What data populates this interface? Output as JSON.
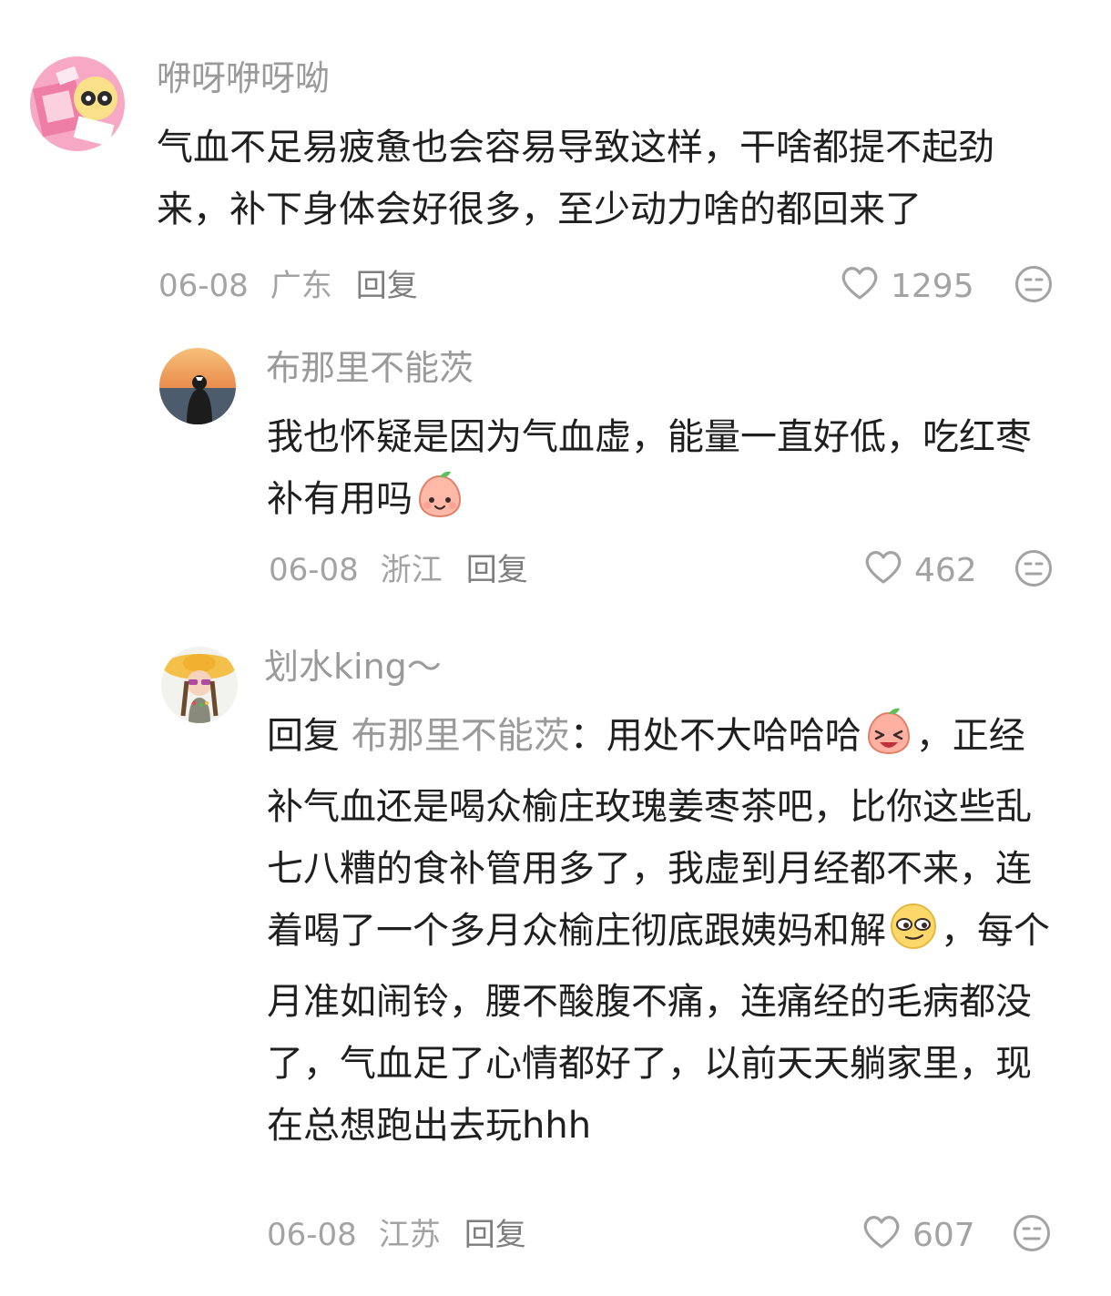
{
  "comments": [
    {
      "username": "咿呀咿呀呦",
      "text": "气血不足易疲惫也会容易导致这样，干啥都提不起劲来，补下身体会好很多，至少动力啥的都回来了",
      "date": "06-08",
      "location": "广东",
      "reply_label": "回复",
      "likes": "1295"
    },
    {
      "username": "布那里不能茨",
      "text": "我也怀疑是因为气血虚，能量一直好低，吃红枣补有用吗",
      "emoji": "smiling-peach-emoji",
      "date": "06-08",
      "location": "浙江",
      "reply_label": "回复",
      "likes": "462"
    },
    {
      "username": "划水king～",
      "reply_prefix": "回复",
      "reply_to": "布那里不能茨",
      "colon": "：",
      "text_part1": "用处不大哈哈哈",
      "emoji1": "laughing-peach-emoji",
      "text_part2": "，正经补气血还是喝众榆庄玫瑰姜枣茶吧，比你这些乱七八糟的食补管用多了，我虚到月经都不来，连着喝了一个多月众榆庄彻底跟姨妈和解",
      "emoji2": "smirking-face-emoji",
      "text_part3": "，每个月准如闹铃，腰不酸腹不痛，连痛经的毛病都没了，气血足了心情都好了，以前天天躺家里，现在总想跑出去玩hhh",
      "date": "06-08",
      "location": "江苏",
      "reply_label": "回复",
      "likes": "607"
    }
  ],
  "icons": {
    "like": "heart-outline-icon",
    "dislike": "meh-face-icon"
  },
  "colors": {
    "username": "#9a9a9a",
    "text": "#1f1f1f",
    "meta": "#a3a3a3"
  }
}
